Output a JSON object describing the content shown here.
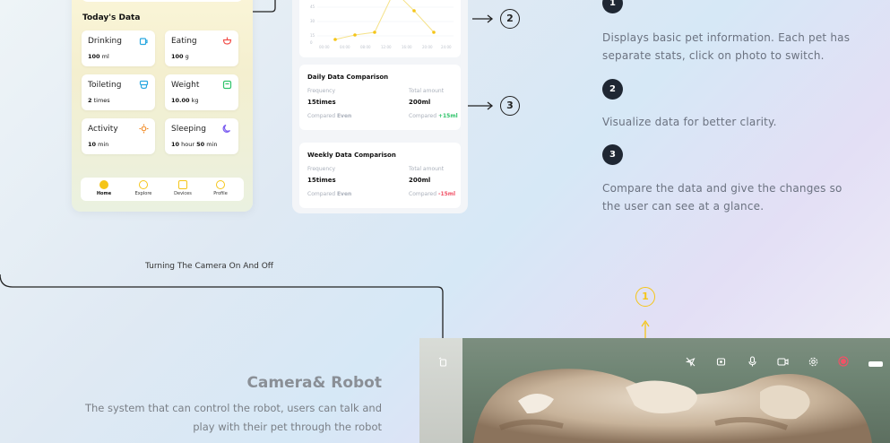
{
  "left_phone": {
    "section_title": "Today's Data",
    "cards": [
      {
        "label": "Drinking",
        "value_num": "100",
        "value_unit": "ml",
        "icon": "cup-icon",
        "icon_color": "#2aa8e0"
      },
      {
        "label": "Eating",
        "value_num": "100",
        "value_unit": "g",
        "icon": "bowl-icon",
        "icon_color": "#f2504b"
      },
      {
        "label": "Toileting",
        "value_num": "2",
        "value_unit": "times",
        "icon": "toilet-icon",
        "icon_color": "#2aa8e0"
      },
      {
        "label": "Weight",
        "value_num": "10.00",
        "value_unit": "kg",
        "icon": "scale-icon",
        "icon_color": "#2fc36a"
      },
      {
        "label": "Activity",
        "value_num": "10",
        "value_unit": "min",
        "icon": "sun-icon",
        "icon_color": "#f28c28"
      },
      {
        "label": "Sleeping",
        "value_num": "10",
        "value_unit": "hour",
        "value_num2": "50",
        "value_unit2": "min",
        "icon": "moon-icon",
        "icon_color": "#7a5cf0"
      }
    ],
    "tabs": [
      {
        "label": "Home",
        "active": true
      },
      {
        "label": "Explore",
        "active": false
      },
      {
        "label": "Devices",
        "active": false
      },
      {
        "label": "Profile",
        "active": false
      }
    ]
  },
  "mid_phone": {
    "chart": {
      "y_ticks": [
        "45",
        "30",
        "15",
        "0"
      ],
      "x_ticks": [
        "00:00",
        "04:00",
        "08:00",
        "12:00",
        "16:00",
        "20:00",
        "24:00"
      ],
      "line_color": "#f5c518"
    },
    "daily": {
      "title": "Daily Data Comparison",
      "freq_label": "Frequency",
      "freq_value": "15times",
      "total_label": "Total amount",
      "total_value": "200ml",
      "compared_label_left": "Compared",
      "compared_value_left": "Even",
      "compared_label_right": "Compared",
      "compared_value_right": "+15ml"
    },
    "weekly": {
      "title": "Weekly Data Comparison",
      "freq_label": "Frequency",
      "freq_value": "15times",
      "total_label": "Total amount",
      "total_value": "200ml",
      "compared_label_left": "Compared",
      "compared_value_left": "Even",
      "compared_label_right": "Compared",
      "compared_value_right": "-15ml"
    }
  },
  "callouts": {
    "c1": "1",
    "c2": "2",
    "c3": "3",
    "desc1": "Displays basic pet information. Each pet has separate stats, click on photo to switch.",
    "desc1_line1": "Displays basic pet information. Each pet has",
    "desc1_line2": "separate stats, click on photo to switch.",
    "desc2": "Visualize data for better clarity.",
    "desc3_line1": "Compare the data and give the changes so",
    "desc3_line2": "the user can see at a glance."
  },
  "caption": "Turning The Camera On And Off",
  "camera": {
    "title": "Camera& Robot",
    "desc_line1": "The system that can control the robot, users can talk and",
    "desc_line2": "play with their pet through the robot",
    "callout": "1"
  }
}
